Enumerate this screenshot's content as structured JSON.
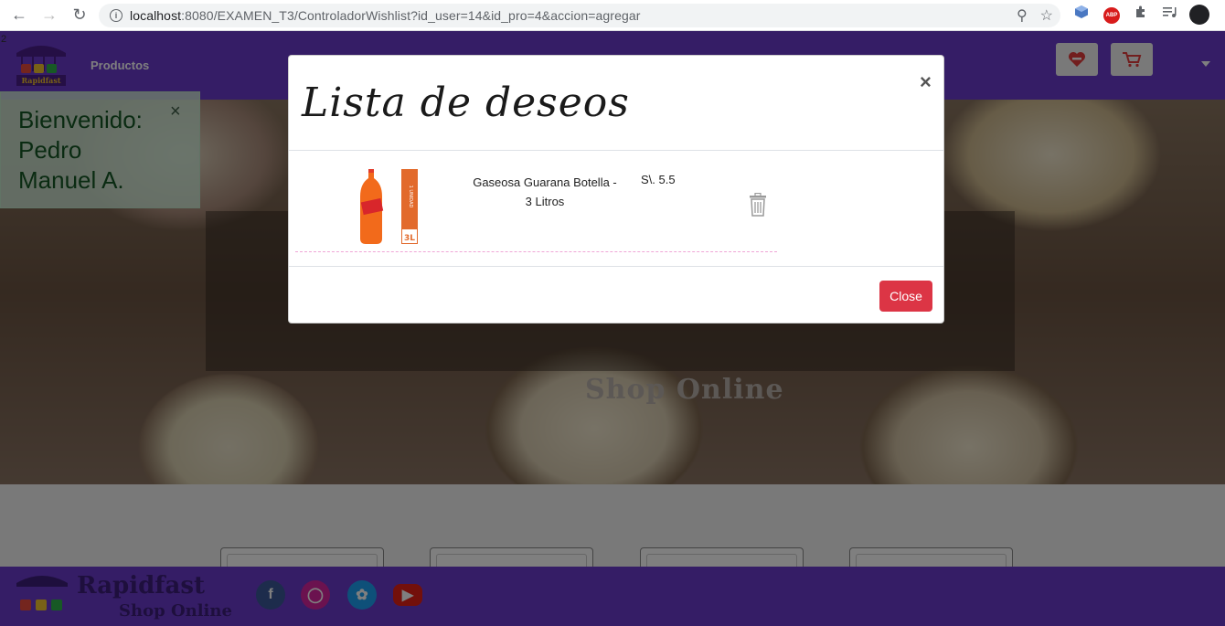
{
  "browser": {
    "url_host": "localhost",
    "url_rest": ":8080/EXAMEN_T3/ControladorWishlist?id_user=14&id_pro=4&accion=agregar"
  },
  "page": {
    "page_marker": "2",
    "nav": {
      "link_productos": "Productos"
    },
    "welcome": {
      "text": "Bienvenido: Pedro Manuel A.",
      "close": "×"
    },
    "hero": {
      "banner_text": "Shop Online"
    },
    "footer": {
      "brand": "Rapidfast",
      "sub": "Shop Online"
    }
  },
  "modal": {
    "title": "Lista de deseos",
    "close_x": "×",
    "item": {
      "name": "Gaseosa Guarana Botella - 3 Litros",
      "price": "S\\. 5.5"
    },
    "close_button": "Close"
  },
  "colors": {
    "navbar": "#6a3bcc",
    "close_button": "#dc3545",
    "row_divider": "#f0a6d6"
  },
  "icons": [
    "back-icon",
    "forward-icon",
    "reload-icon",
    "info-icon",
    "zoom-icon",
    "star-icon",
    "heart-icon",
    "cart-icon",
    "trash-icon",
    "facebook-icon",
    "instagram-icon",
    "twitter-icon",
    "youtube-icon"
  ]
}
